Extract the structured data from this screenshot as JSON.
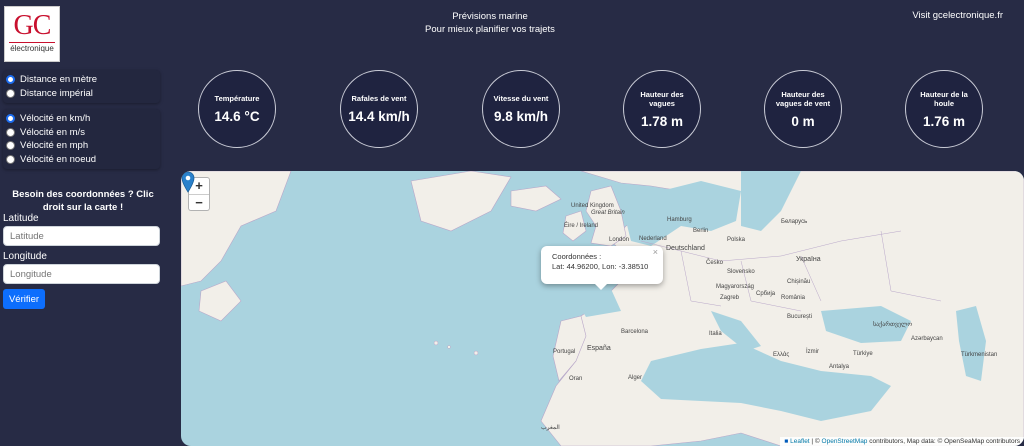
{
  "logo": {
    "main": "GC",
    "sub": "électronique"
  },
  "header": {
    "title": "Prévisions marine",
    "subtitle": "Pour mieux planifier vos trajets",
    "visit_link": "Visit gcelectronique.fr"
  },
  "distance_options": [
    {
      "label": "Distance en mètre",
      "selected": true
    },
    {
      "label": "Distance impérial",
      "selected": false
    }
  ],
  "velocity_options": [
    {
      "label": "Vélocité en km/h",
      "selected": true
    },
    {
      "label": "Vélocité en m/s",
      "selected": false
    },
    {
      "label": "Vélocité en mph",
      "selected": false
    },
    {
      "label": "Vélocité en noeud",
      "selected": false
    }
  ],
  "coords_form": {
    "title": "Besoin des coordonnées ? Clic droit sur la carte !",
    "latitude_label": "Latitude",
    "latitude_placeholder": "Latitude",
    "longitude_label": "Longitude",
    "longitude_placeholder": "Longitude",
    "submit_label": "Vérifier"
  },
  "metrics": [
    {
      "label": "Température",
      "value": "14.6 °C"
    },
    {
      "label": "Rafales de vent",
      "value": "14.4 km/h"
    },
    {
      "label": "Vitesse du vent",
      "value": "9.8 km/h"
    },
    {
      "label": "Hauteur des vagues",
      "value": "1.78 m"
    },
    {
      "label": "Hauteur des vagues de vent",
      "value": "0 m"
    },
    {
      "label": "Hauteur de la houle",
      "value": "1.76 m"
    }
  ],
  "map": {
    "zoom_in": "+",
    "zoom_out": "−",
    "popup": {
      "title": "Coordonnées :",
      "coords": "Lat: 44.96200, Lon: -3.38510",
      "close": "×"
    },
    "labels": {
      "united_kingdom": "United Kingdom",
      "great_britain": "Great Britain",
      "ireland": "Éire / Ireland",
      "london": "London",
      "hamburg": "Hamburg",
      "berlin": "Berlin",
      "nederland": "Nederland",
      "deutschland": "Deutschland",
      "polska": "Polska",
      "cesko": "Česko",
      "slovensko": "Slovensko",
      "magyarorszag": "Magyarország",
      "zagreb": "Zagreb",
      "srbija": "Србија",
      "romania": "România",
      "bucuresti": "București",
      "chisinau": "Chișinău",
      "ukraina": "Україна",
      "belarus": "Беларусь",
      "italia": "Italia",
      "barcelona": "Barcelona",
      "espana": "España",
      "portugal": "Portugal",
      "alger": "Alger",
      "ellas": "Ελλάς",
      "izmir": "İzmir",
      "turkiye": "Türkiye",
      "antalya": "Antalya",
      "turkmenistan": "Türkmenistan",
      "azerbaycan": "Azərbaycan",
      "sakartvelo": "საქართველო",
      "maroc": "المغرب",
      "oran": "Oran"
    },
    "attribution": {
      "leaflet": "Leaflet",
      "osm": "OpenStreetMap",
      "text_before": " | © ",
      "text_after": " contributors, Map data: © OpenSeaMap contributors"
    }
  }
}
